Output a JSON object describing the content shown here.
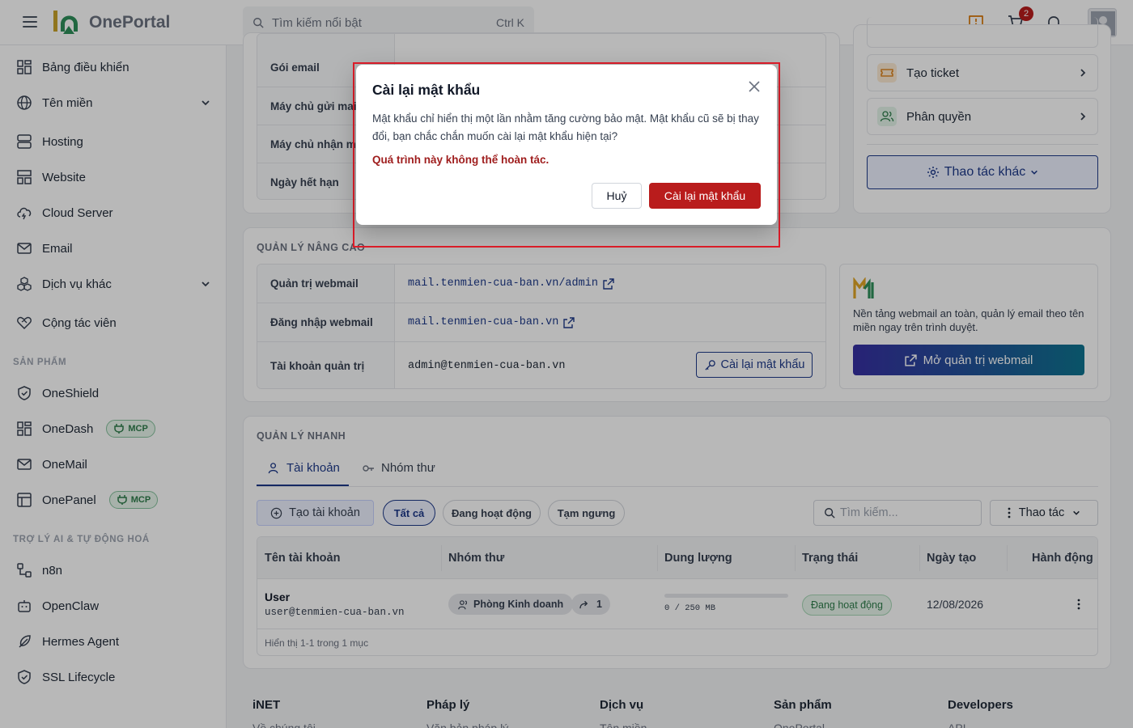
{
  "header": {
    "logo_text": "OnePortal",
    "search_placeholder": "Tìm kiếm nổi bật",
    "search_shortcut": "Ctrl K",
    "cart_count": "2"
  },
  "sidebar": {
    "items": [
      {
        "label": "Bảng điều khiển"
      },
      {
        "label": "Tên miền"
      },
      {
        "label": "Hosting"
      },
      {
        "label": "Website"
      },
      {
        "label": "Cloud Server"
      },
      {
        "label": "Email"
      },
      {
        "label": "Dịch vụ khác"
      },
      {
        "label": "Cộng tác viên"
      }
    ],
    "products_label": "SẢN PHẨM",
    "products": [
      {
        "label": "OneShield"
      },
      {
        "label": "OneDash",
        "badge": "MCP"
      },
      {
        "label": "OneMail"
      },
      {
        "label": "OnePanel",
        "badge": "MCP"
      }
    ],
    "ai_label": "TRỢ LÝ AI & TỰ ĐỘNG HOÁ",
    "ai_items": [
      {
        "label": "n8n"
      },
      {
        "label": "OpenClaw"
      },
      {
        "label": "Hermes Agent"
      },
      {
        "label": "SSL Lifecycle"
      }
    ]
  },
  "info_card": {
    "rows": [
      {
        "key": "Gói email"
      },
      {
        "key": "Máy chủ gửi mail"
      },
      {
        "key": "Máy chủ nhận mail"
      },
      {
        "key": "Ngày hết hạn"
      }
    ]
  },
  "side_actions": {
    "create_ticket": "Tạo ticket",
    "permissions": "Phân quyền",
    "more_actions": "Thao tác khác"
  },
  "advanced": {
    "title": "QUẢN LÝ NÂNG CAO",
    "rows": [
      {
        "key": "Quản trị webmail",
        "value": "mail.tenmien-cua-ban.vn/admin"
      },
      {
        "key": "Đăng nhập webmail",
        "value": "mail.tenmien-cua-ban.vn"
      },
      {
        "key": "Tài khoản quản trị",
        "value": "admin@tenmien-cua-ban.vn"
      }
    ],
    "reset_button": "Cài lại mật khẩu",
    "promo_text": "Nền tảng webmail an toàn, quản lý email theo tên miền ngay trên trình duyệt.",
    "promo_button": "Mở quản trị webmail"
  },
  "quick": {
    "title": "QUẢN LÝ NHANH",
    "tabs": [
      {
        "label": "Tài khoản"
      },
      {
        "label": "Nhóm thư"
      }
    ],
    "create_button": "Tạo tài khoản",
    "filters": [
      {
        "label": "Tất cả"
      },
      {
        "label": "Đang hoạt động"
      },
      {
        "label": "Tạm ngưng"
      }
    ],
    "search_placeholder": "Tìm kiếm...",
    "actions_label": "Thao tác",
    "columns": [
      "Tên tài khoản",
      "Nhóm thư",
      "Dung lượng",
      "Trạng thái",
      "Ngày tạo",
      "Hành động"
    ],
    "rows": [
      {
        "name": "User",
        "email": "user@tenmien-cua-ban.vn",
        "group": "Phòng Kinh doanh",
        "forward_count": "1",
        "usage": "0 / 250 MB",
        "usage_fraction": 0,
        "status": "Đang hoạt động",
        "created": "12/08/2026"
      }
    ],
    "summary": "Hiển thị 1-1 trong 1 mục"
  },
  "footer": {
    "columns": [
      {
        "title": "iNET",
        "first": "Về chúng tôi"
      },
      {
        "title": "Pháp lý",
        "first": "Văn bản pháp lý"
      },
      {
        "title": "Dịch vụ",
        "first": "Tên miền"
      },
      {
        "title": "Sản phẩm",
        "first": "OnePortal"
      },
      {
        "title": "Developers",
        "first": "API"
      }
    ]
  },
  "modal": {
    "title": "Cài lại mật khẩu",
    "body": "Mật khẩu chỉ hiển thị một lần nhằm tăng cường bảo mật. Mật khẩu cũ sẽ bị thay đổi, bạn chắc chắn muốn cài lại mật khẩu hiện tại?",
    "warning": "Quá trình này không thể hoàn tác.",
    "cancel": "Huỷ",
    "confirm": "Cài lại mật khẩu"
  },
  "colors": {
    "accent": "#1e3a8a",
    "danger": "#b91c1c",
    "highlight": "#e11d2a",
    "success": "#2f7d4b"
  }
}
